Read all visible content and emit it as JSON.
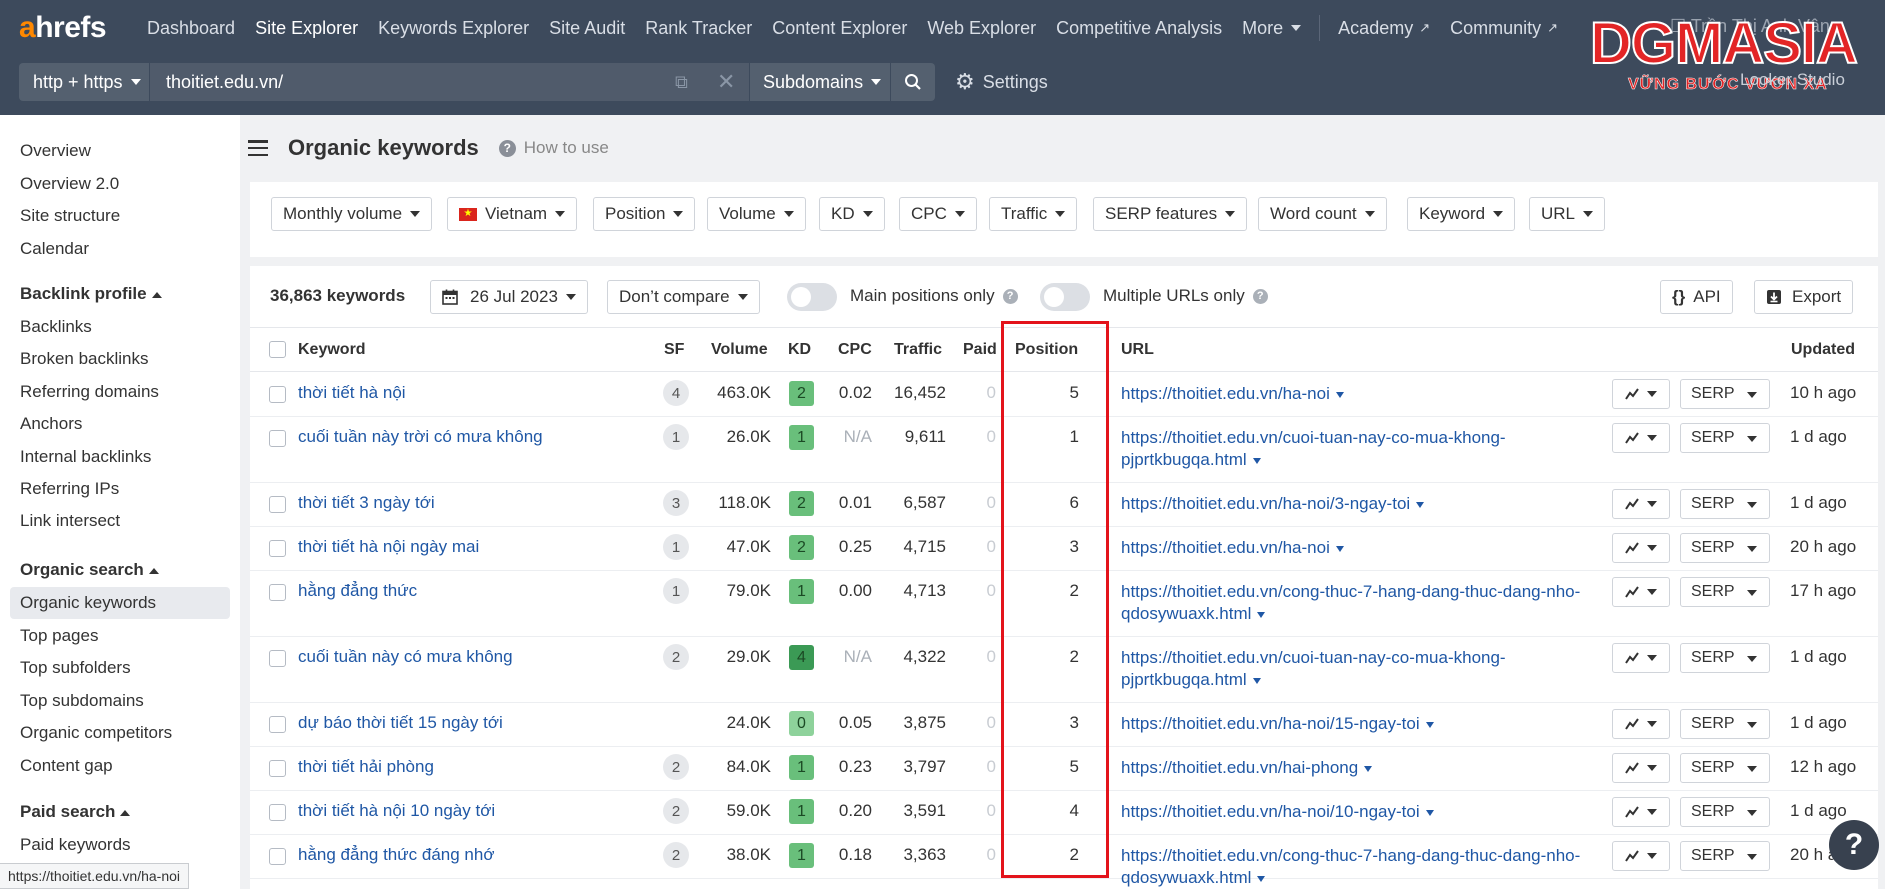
{
  "nav": {
    "logo_a": "a",
    "logo_rest": "hrefs",
    "items": [
      "Dashboard",
      "Site Explorer",
      "Keywords Explorer",
      "Site Audit",
      "Rank Tracker",
      "Content Explorer",
      "Web Explorer",
      "Competitive Analysis",
      "More"
    ],
    "active": "Site Explorer",
    "academy": "Academy",
    "community": "Community"
  },
  "search": {
    "protocol": "http + https",
    "url": "thoitiet.edu.vn/",
    "mode": "Subdomains",
    "settings": "Settings"
  },
  "watermark": {
    "brand": "DGMASIA",
    "tagline": "VỮNG BƯỚC VƯƠN XA",
    "looker": "Looker Studio"
  },
  "sidebar": {
    "top": [
      "Overview",
      "Overview 2.0",
      "Site structure",
      "Calendar"
    ],
    "backlink_head": "Backlink profile",
    "backlink": [
      "Backlinks",
      "Broken backlinks",
      "Referring domains",
      "Anchors",
      "Internal backlinks",
      "Referring IPs",
      "Link intersect"
    ],
    "organic_head": "Organic search",
    "organic": [
      "Organic keywords",
      "Top pages",
      "Top subfolders",
      "Top subdomains",
      "Organic competitors",
      "Content gap"
    ],
    "paid_head": "Paid search",
    "paid": [
      "Paid keywords"
    ]
  },
  "page": {
    "title": "Organic keywords",
    "how_to_use": "How to use"
  },
  "filters": [
    "Monthly volume",
    "Vietnam",
    "Position",
    "Volume",
    "KD",
    "CPC",
    "Traffic",
    "SERP features",
    "Word count",
    "Keyword",
    "URL"
  ],
  "toolbar": {
    "count": "36,863 keywords",
    "date": "26 Jul 2023",
    "compare": "Don’t compare",
    "main_positions": "Main positions only",
    "multiple_urls": "Multiple URLs only",
    "api": "API",
    "export": "Export"
  },
  "table": {
    "headers": {
      "keyword": "Keyword",
      "sf": "SF",
      "volume": "Volume",
      "kd": "KD",
      "cpc": "CPC",
      "traffic": "Traffic",
      "paid": "Paid",
      "position": "Position",
      "url": "URL",
      "updated": "Updated"
    },
    "serp_label": "SERP",
    "rows": [
      {
        "keyword": "thời tiết hà nội",
        "sf": "4",
        "volume": "463.0K",
        "kd": "2",
        "cpc": "0.02",
        "traffic": "16,452",
        "paid": "0",
        "position": "5",
        "url": "https://thoitiet.edu.vn/ha-noi",
        "updated": "10 h ago"
      },
      {
        "keyword": "cuối tuần này trời có mưa không",
        "sf": "1",
        "volume": "26.0K",
        "kd": "1",
        "cpc": "N/A",
        "traffic": "9,611",
        "paid": "0",
        "position": "1",
        "url": "https://thoitiet.edu.vn/cuoi-tuan-nay-co-mua-khong-pjprtkbugqa.html",
        "updated": "1 d ago"
      },
      {
        "keyword": "thời tiết 3 ngày tới",
        "sf": "3",
        "volume": "118.0K",
        "kd": "2",
        "cpc": "0.01",
        "traffic": "6,587",
        "paid": "0",
        "position": "6",
        "url": "https://thoitiet.edu.vn/ha-noi/3-ngay-toi",
        "updated": "1 d ago"
      },
      {
        "keyword": "thời tiết hà nội ngày mai",
        "sf": "1",
        "volume": "47.0K",
        "kd": "2",
        "cpc": "0.25",
        "traffic": "4,715",
        "paid": "0",
        "position": "3",
        "url": "https://thoitiet.edu.vn/ha-noi",
        "updated": "20 h ago"
      },
      {
        "keyword": "hằng đẳng thức",
        "sf": "1",
        "volume": "79.0K",
        "kd": "1",
        "cpc": "0.00",
        "traffic": "4,713",
        "paid": "0",
        "position": "2",
        "url": "https://thoitiet.edu.vn/cong-thuc-7-hang-dang-thuc-dang-nho-qdosywuaxk.html",
        "updated": "17 h ago"
      },
      {
        "keyword": "cuối tuần này có mưa không",
        "sf": "2",
        "volume": "29.0K",
        "kd": "4",
        "cpc": "N/A",
        "traffic": "4,322",
        "paid": "0",
        "position": "2",
        "url": "https://thoitiet.edu.vn/cuoi-tuan-nay-co-mua-khong-pjprtkbugqa.html",
        "updated": "1 d ago"
      },
      {
        "keyword": "dự báo thời tiết 15 ngày tới",
        "sf": "",
        "volume": "24.0K",
        "kd": "0",
        "cpc": "0.05",
        "traffic": "3,875",
        "paid": "0",
        "position": "3",
        "url": "https://thoitiet.edu.vn/ha-noi/15-ngay-toi",
        "updated": "1 d ago"
      },
      {
        "keyword": "thời tiết hải phòng",
        "sf": "2",
        "volume": "84.0K",
        "kd": "1",
        "cpc": "0.23",
        "traffic": "3,797",
        "paid": "0",
        "position": "5",
        "url": "https://thoitiet.edu.vn/hai-phong",
        "updated": "12 h ago"
      },
      {
        "keyword": "thời tiết hà nội 10 ngày tới",
        "sf": "2",
        "volume": "59.0K",
        "kd": "1",
        "cpc": "0.20",
        "traffic": "3,591",
        "paid": "0",
        "position": "4",
        "url": "https://thoitiet.edu.vn/ha-noi/10-ngay-toi",
        "updated": "1 d ago"
      },
      {
        "keyword": "hằng đẳng thức đáng nhớ",
        "sf": "2",
        "volume": "38.0K",
        "kd": "1",
        "cpc": "0.18",
        "traffic": "3,363",
        "paid": "0",
        "position": "2",
        "url": "https://thoitiet.edu.vn/cong-thuc-7-hang-dang-thuc-dang-nho-qdosywuaxk.html",
        "updated": "20 h ago"
      }
    ]
  },
  "statusbar": "https://thoitiet.edu.vn/ha-noi",
  "help": "?",
  "colors": {
    "nav_bg": "#3d4a5c",
    "link": "#1f57a5",
    "kd_green": "#69bf7b",
    "highlight": "#e3131b",
    "logo_orange": "#ff8800"
  }
}
